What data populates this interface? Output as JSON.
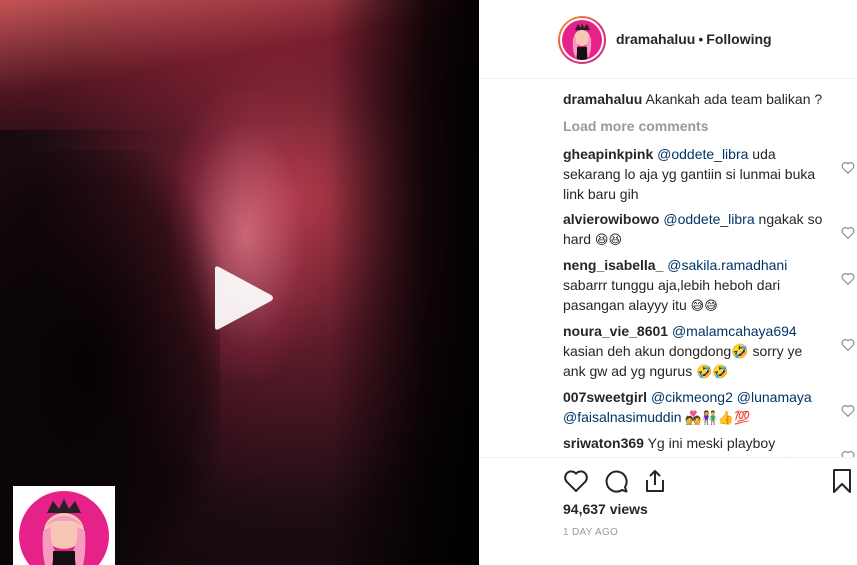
{
  "post": {
    "username": "dramahaluu",
    "separator": "•",
    "follow_status": "Following",
    "caption": "Akankah ada team balikan ?",
    "load_more": "Load more comments",
    "views": "94,637 views",
    "time_ago": "1 DAY AGO"
  },
  "comments": [
    {
      "user": "gheapinkpink",
      "mention": "@oddete_libra",
      "text": "uda sekarang lo aja yg gantiin si lunmai buka link baru gih",
      "emoji": ""
    },
    {
      "user": "alvierowibowo",
      "mention": "@oddete_libra",
      "text": "ngakak so hard",
      "emoji": "😆😆"
    },
    {
      "user": "neng_isabella_",
      "mention": "@sakila.ramadhani",
      "text": "sabarrr tunggu aja,lebih heboh dari pasangan alayyy itu",
      "emoji": "😅😅"
    },
    {
      "user": "noura_vie_8601",
      "mention": "@malamcahaya694",
      "text": "kasian deh akun dongdong🤣 sorry ye ank gw ad yg ngurus",
      "emoji": "🤣🤣"
    },
    {
      "user": "007sweetgirl",
      "mention": "@cikmeong2 @lunamaya @faisalnasimuddin",
      "text": "",
      "emoji": "💑👫👍💯"
    },
    {
      "user": "sriwaton369",
      "mention": "",
      "text": "Yg ini meski playboy seenggak nya dia lebih gentleman",
      "emoji": "👍"
    }
  ],
  "icons": {
    "play": "play-icon",
    "heart": "heart-icon",
    "comment": "comment-icon",
    "share": "share-icon",
    "save": "bookmark-icon"
  },
  "colors": {
    "mention": "#003569",
    "muted": "#999999",
    "avatar_pink": "#e6218a"
  }
}
